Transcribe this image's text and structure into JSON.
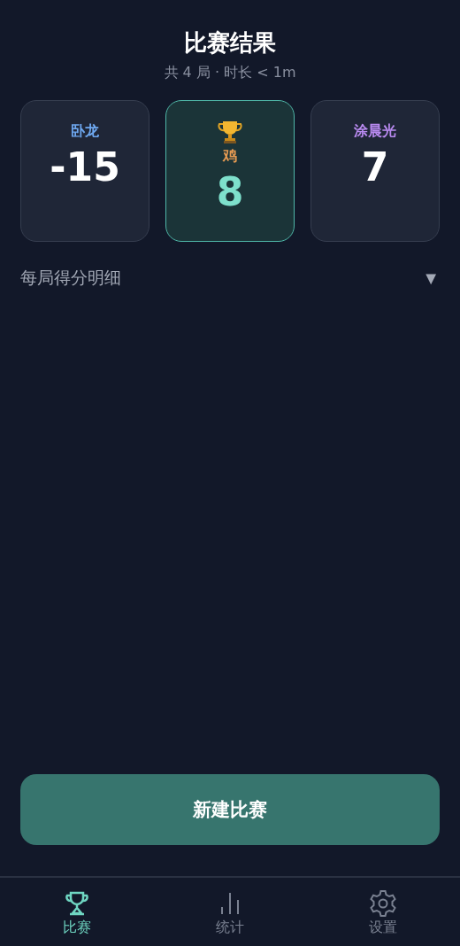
{
  "header": {
    "title": "比赛结果",
    "subtitle": "共 4 局 · 时长 < 1m"
  },
  "players": [
    {
      "name": "卧龙",
      "color": "#6ea8f0",
      "score": "-15",
      "winner": false
    },
    {
      "name": "鸡",
      "color": "#e59a52",
      "score": "8",
      "winner": true
    },
    {
      "name": "涂晨光",
      "color": "#b98af0",
      "score": "7",
      "winner": false
    }
  ],
  "details": {
    "label": "每局得分明细",
    "toggle": "▼",
    "expanded": false
  },
  "new_game_button": "新建比赛",
  "tabs": [
    {
      "label": "比赛",
      "selected": true
    },
    {
      "label": "统计",
      "selected": false
    },
    {
      "label": "设置",
      "selected": false
    }
  ]
}
